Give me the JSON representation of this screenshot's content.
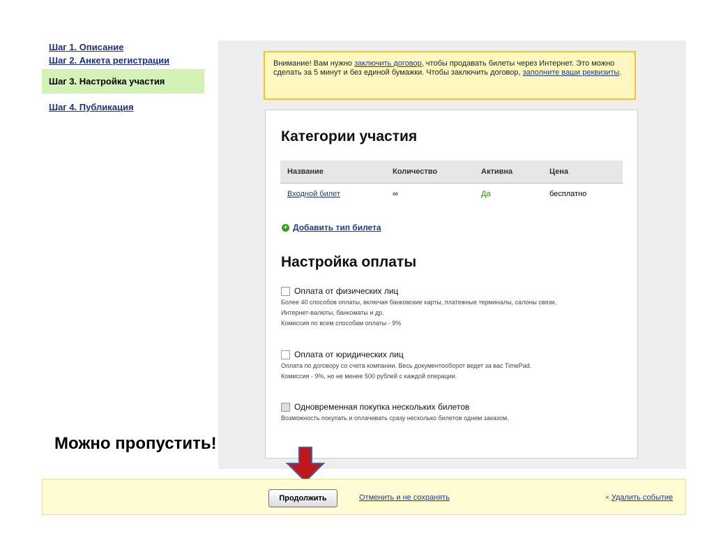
{
  "steps": {
    "step1": "Шаг 1. Описание",
    "step2": "Шаг 2. Анкета регистрации",
    "step3": "Шаг 3. Настройка участия",
    "step4": "Шаг 4. Публикация"
  },
  "notice": {
    "part1": "Внимание! Вам нужно ",
    "link1": "заключить договор",
    "part2": ", чтобы продавать билеты через Интернет. Это можно сделать за 5 минут и без единой бумажки. Чтобы заключить договор, ",
    "link2": "заполните ваши реквизиты",
    "part3": "."
  },
  "categories": {
    "heading": "Категории участия",
    "columns": [
      "Название",
      "Количество",
      "Активна",
      "Цена"
    ],
    "rows": [
      {
        "name": "Входной билет",
        "quantity": "∞",
        "active": "Да",
        "price": "бесплатно"
      }
    ],
    "add_ticket": "Добавить тип билета",
    "active_color": "#2c8a1c"
  },
  "payment": {
    "heading": "Настройка оплаты",
    "options": [
      {
        "title": "Оплата от физических лиц",
        "desc": [
          "Более 40 способов оплаты, включая банковские карты, платежные терминалы, салоны связи,",
          "Интернет-валюты, банкоматы и др.",
          "Комиссия по всем способам оплаты - 9%"
        ]
      },
      {
        "title": "Оплата от юридических лиц",
        "desc": [
          "Оплата по договору со счета компании. Весь документооборот ведет за вас TimePad.",
          "Комиссия - 9%, но не менее 500 рублей с каждой операции."
        ]
      },
      {
        "title": "Одновременная покупка нескольких билетов",
        "desc": [
          "Возможность покупать и оплачивать сразу несколько билетов одним заказом."
        ]
      }
    ]
  },
  "annotation": {
    "skip": "Можно пропустить!",
    "arrow_color": "#c0171c"
  },
  "footer": {
    "continue": "Продолжить",
    "cancel": "Отменить и не сохранять",
    "delete": "Удалить событие"
  }
}
